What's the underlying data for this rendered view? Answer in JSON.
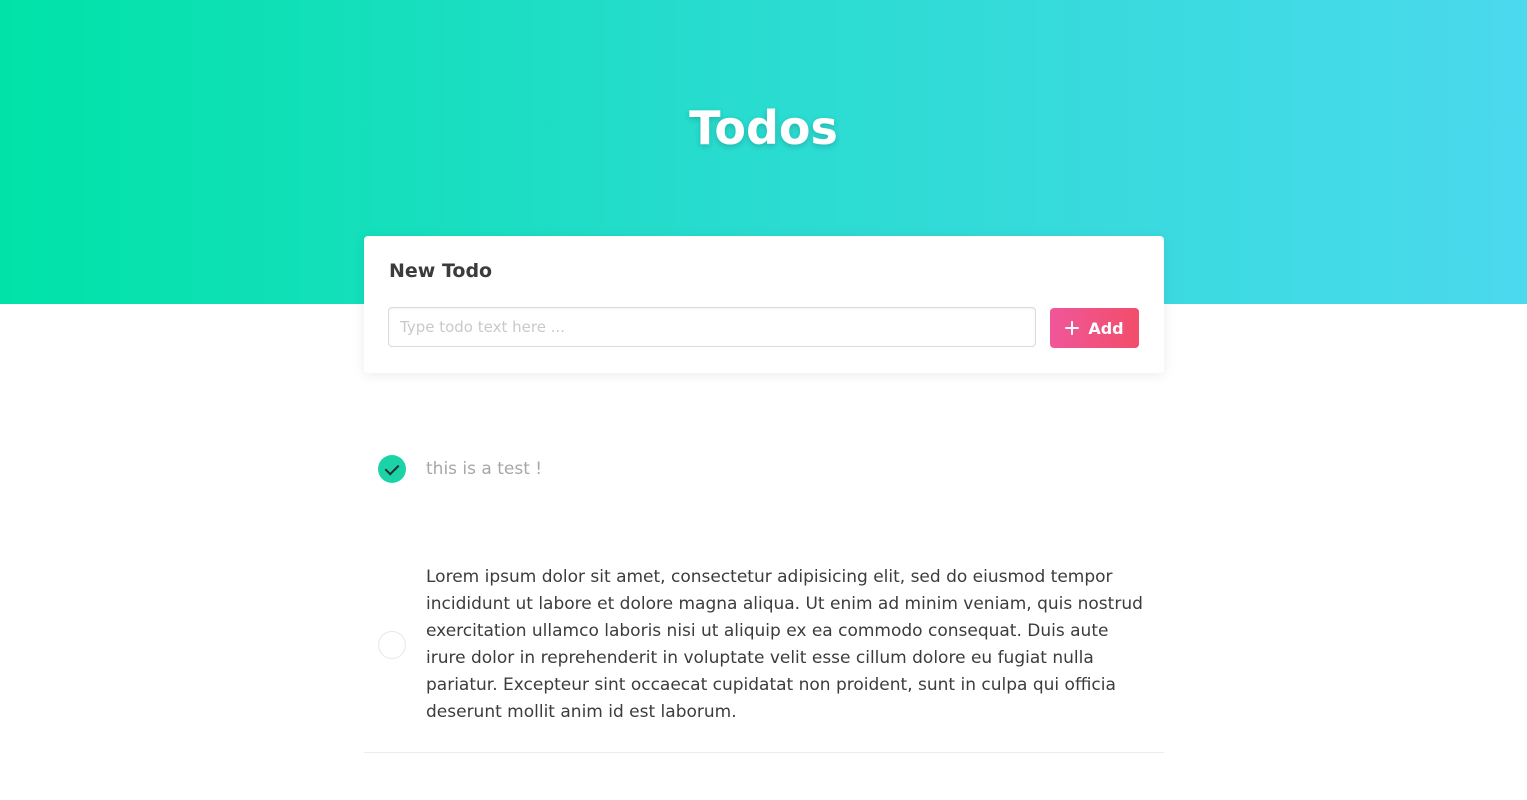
{
  "header": {
    "title": "Todos",
    "gradient_start": "#00e3a7",
    "gradient_end": "#4bd9ee"
  },
  "new_todo": {
    "title": "New Todo",
    "input_placeholder": "Type todo text here ...",
    "input_value": "",
    "add_label": "Add",
    "add_icon": "plus-icon",
    "button_color": "#f24d6a"
  },
  "todos": [
    {
      "text": "this is a test !",
      "completed": true
    },
    {
      "text": "Lorem ipsum dolor sit amet, consectetur adipisicing elit, sed do eiusmod tempor incididunt ut labore et dolore magna aliqua. Ut enim ad minim veniam, quis nostrud exercitation ullamco laboris nisi ut aliquip ex ea commodo consequat. Duis aute irure dolor in reprehenderit in voluptate velit esse cillum dolore eu fugiat nulla pariatur. Excepteur sint occaecat cupidatat non proident, sunt in culpa qui officia deserunt mollit anim id est laborum.",
      "completed": false
    }
  ]
}
